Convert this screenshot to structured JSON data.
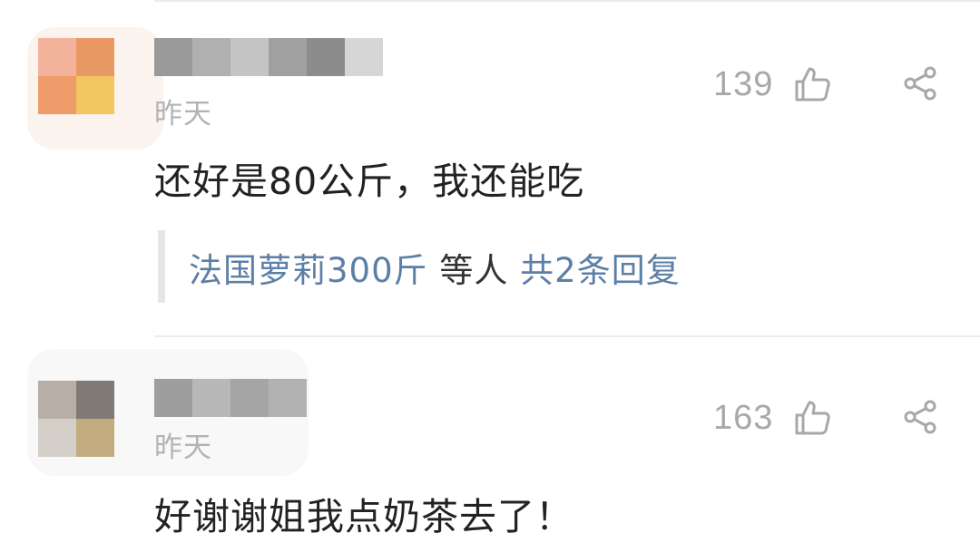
{
  "comments": [
    {
      "time": "昨天",
      "likes": "139",
      "content": "还好是80公斤，我还能吃",
      "reply_preview": {
        "names": "法国萝莉300斤",
        "middle": " 等人 ",
        "count_text": "共2条回复"
      },
      "avatar_colors": [
        "#f3b39a",
        "#e99a64",
        "#ef9c6a",
        "#f2c661"
      ],
      "username_mosaic_colors": [
        "#9a9a9a",
        "#b0b0b0",
        "#c4c4c4",
        "#a0a0a0",
        "#8c8c8c",
        "#d6d6d6"
      ]
    },
    {
      "time": "昨天",
      "likes": "163",
      "content": "好谢谢姐我点奶茶去了！",
      "avatar_colors": [
        "#b8aea6",
        "#7f7a73",
        "#d3cfc8",
        "#c2ab7e"
      ],
      "username_mosaic_colors": [
        "#9e9e9e",
        "#b8b8b8",
        "#a5a5a5",
        "#b2b2b2"
      ]
    }
  ],
  "icons": {
    "like": "thumbs-up-icon",
    "share": "share-icon"
  }
}
